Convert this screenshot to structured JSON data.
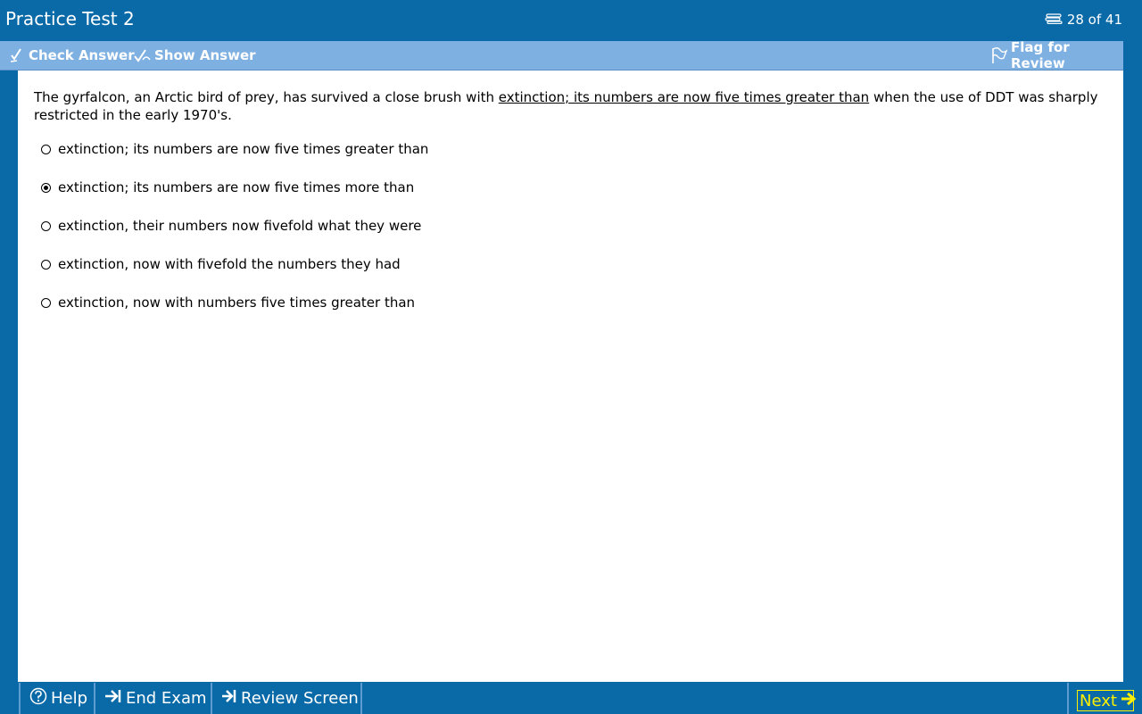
{
  "window": {
    "title": "Practice Test 2",
    "counter": "28 of 41"
  },
  "toolbar": {
    "check_answer": "Check Answer",
    "show_answer": "Show Answer",
    "flag_for_review": "Flag for Review"
  },
  "question": {
    "text_before": "The gyrfalcon, an Arctic bird of prey, has survived a close brush with ",
    "underlined": "extinction; its numbers are now five times greater than",
    "text_after": " when the use of DDT was sharply restricted in the early 1970's."
  },
  "options": [
    {
      "label": "extinction; its numbers are now five times greater than",
      "selected": false
    },
    {
      "label": "extinction; its numbers are now five times more than",
      "selected": true
    },
    {
      "label": "extinction, their numbers now fivefold what they were",
      "selected": false
    },
    {
      "label": "extinction, now with fivefold the numbers they had",
      "selected": false
    },
    {
      "label": "extinction, now with numbers five times greater than",
      "selected": false
    }
  ],
  "bottom": {
    "help": "Help",
    "end_exam": "End Exam",
    "review_screen": "Review Screen",
    "next": "Next"
  },
  "colors": {
    "frame": "#0a6aa8",
    "toolbar": "#7fb0e2",
    "next_highlight": "#ffef00"
  },
  "icons": {
    "counter": "stack-icon",
    "check_answer": "check-pen-icon",
    "show_answer": "show-answer-icon",
    "flag": "flag-icon",
    "help": "help-icon",
    "end_exam": "end-exam-arrow-icon",
    "review": "review-arrow-icon",
    "next": "next-arrow-icon"
  }
}
